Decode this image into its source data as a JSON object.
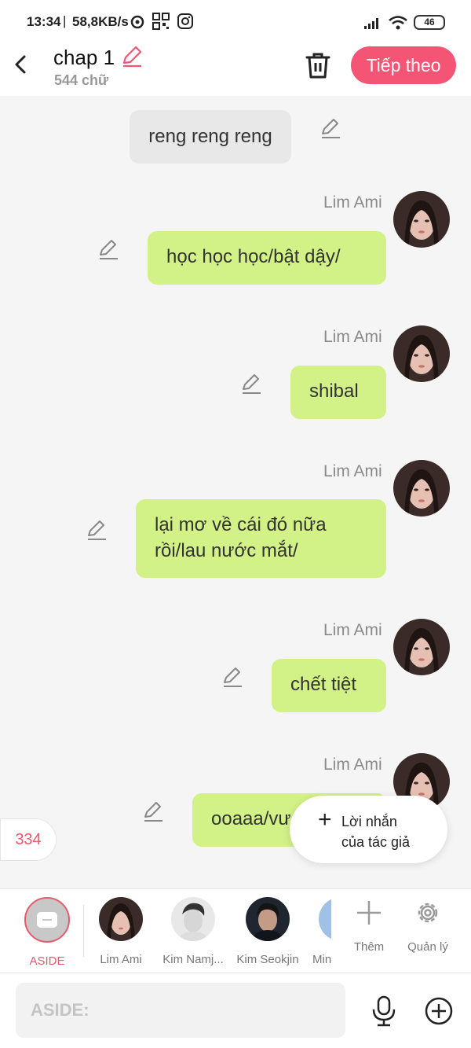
{
  "status_bar": {
    "time": "13:34",
    "separator": "|",
    "net_speed": "58,8KB/s",
    "battery": "46"
  },
  "header": {
    "title": "chap 1",
    "word_count": "544 chữ",
    "next_label": "Tiếp theo"
  },
  "messages": [
    {
      "type": "narration",
      "text": "reng reng reng"
    },
    {
      "type": "character",
      "speaker": "Lim Ami",
      "text": "học học học/bật dậy/"
    },
    {
      "type": "character",
      "speaker": "Lim Ami",
      "text": "shibal"
    },
    {
      "type": "character",
      "speaker": "Lim Ami",
      "line1": "lại mơ về cái đó nữa",
      "line2": "rồi/lau nước mắt/"
    },
    {
      "type": "character",
      "speaker": "Lim Ami",
      "text": "chết tiệt"
    },
    {
      "type": "character",
      "speaker": "Lim Ami",
      "text": "ooaaa/vươn vai/"
    }
  ],
  "count_badge": "334",
  "author_note": {
    "line1": "Lời nhắn",
    "line2": "của tác giả"
  },
  "characters": [
    {
      "name": "ASIDE",
      "selected": true
    },
    {
      "name": "Lim Ami"
    },
    {
      "name": "Kim Namj..."
    },
    {
      "name": "Kim Seokjin"
    },
    {
      "name": "Min"
    }
  ],
  "actions": {
    "add_label": "Thêm",
    "manage_label": "Quản lý"
  },
  "input": {
    "placeholder": "ASIDE:"
  },
  "colors": {
    "accent": "#f55574",
    "bubble": "#d2f187",
    "narration": "#e8e8e8",
    "selected": "#e65a6d"
  }
}
